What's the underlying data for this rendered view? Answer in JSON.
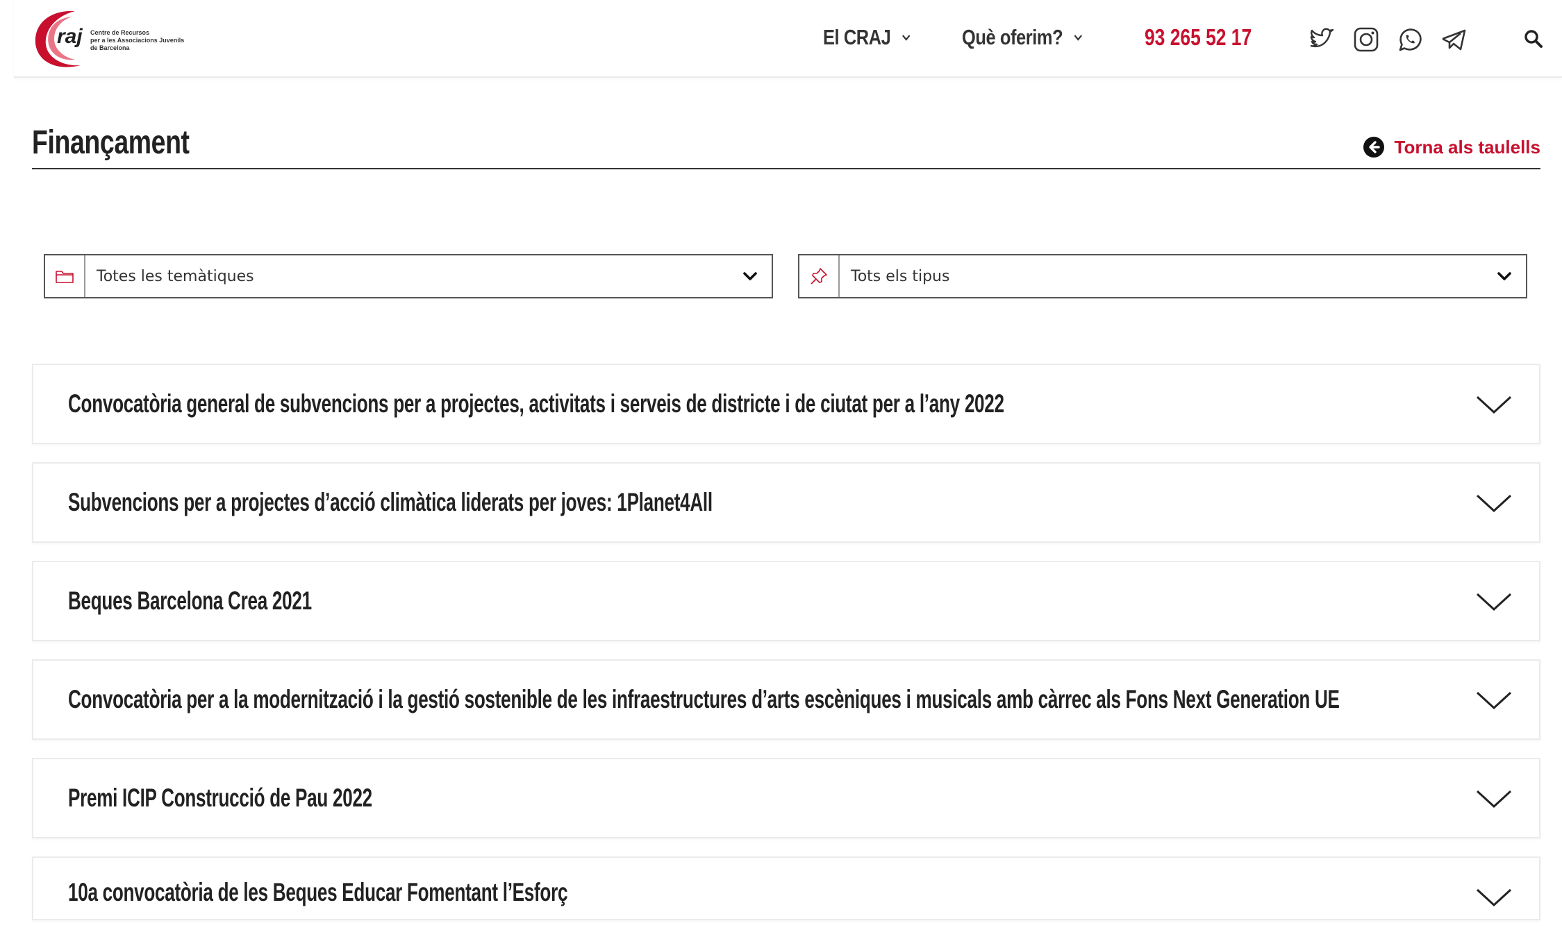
{
  "header": {
    "logo": {
      "mark_text": "raj",
      "line1": "Centre de Recursos",
      "line2": "per a les Associacions Juvenils",
      "line3": "de Barcelona"
    },
    "nav": [
      {
        "label": "El CRAJ"
      },
      {
        "label": "Què oferim?"
      }
    ],
    "phone": "93 265 52 17",
    "social_icons": [
      "twitter-icon",
      "instagram-icon",
      "whatsapp-icon",
      "telegram-icon"
    ],
    "search_icon": "search-icon"
  },
  "page": {
    "title": "Finançament",
    "back_link": "Torna als taulells"
  },
  "filters": {
    "tematiques": {
      "value": "Totes les temàtiques",
      "icon": "folder-icon"
    },
    "tipus": {
      "value": "Tots els tipus",
      "icon": "pin-icon"
    }
  },
  "items": [
    {
      "title": "Convocatòria general de subvencions per a projectes, activitats i serveis de districte i de ciutat per a l’any 2022"
    },
    {
      "title": "Subvencions per a projectes d’acció climàtica liderats per joves: 1Planet4All"
    },
    {
      "title": "Beques Barcelona Crea 2021"
    },
    {
      "title": "Convocatòria per a la modernització i la gestió sostenible de les infraestructures d’arts escèniques i musicals amb càrrec als Fons Next Generation UE"
    },
    {
      "title": "Premi ICIP Construcció de Pau 2022"
    },
    {
      "title": "10a convocatòria de les Beques Educar Fomentant l’Esforç"
    }
  ],
  "colors": {
    "accent": "#c8102e",
    "text": "#222222",
    "border": "#ebebeb"
  }
}
